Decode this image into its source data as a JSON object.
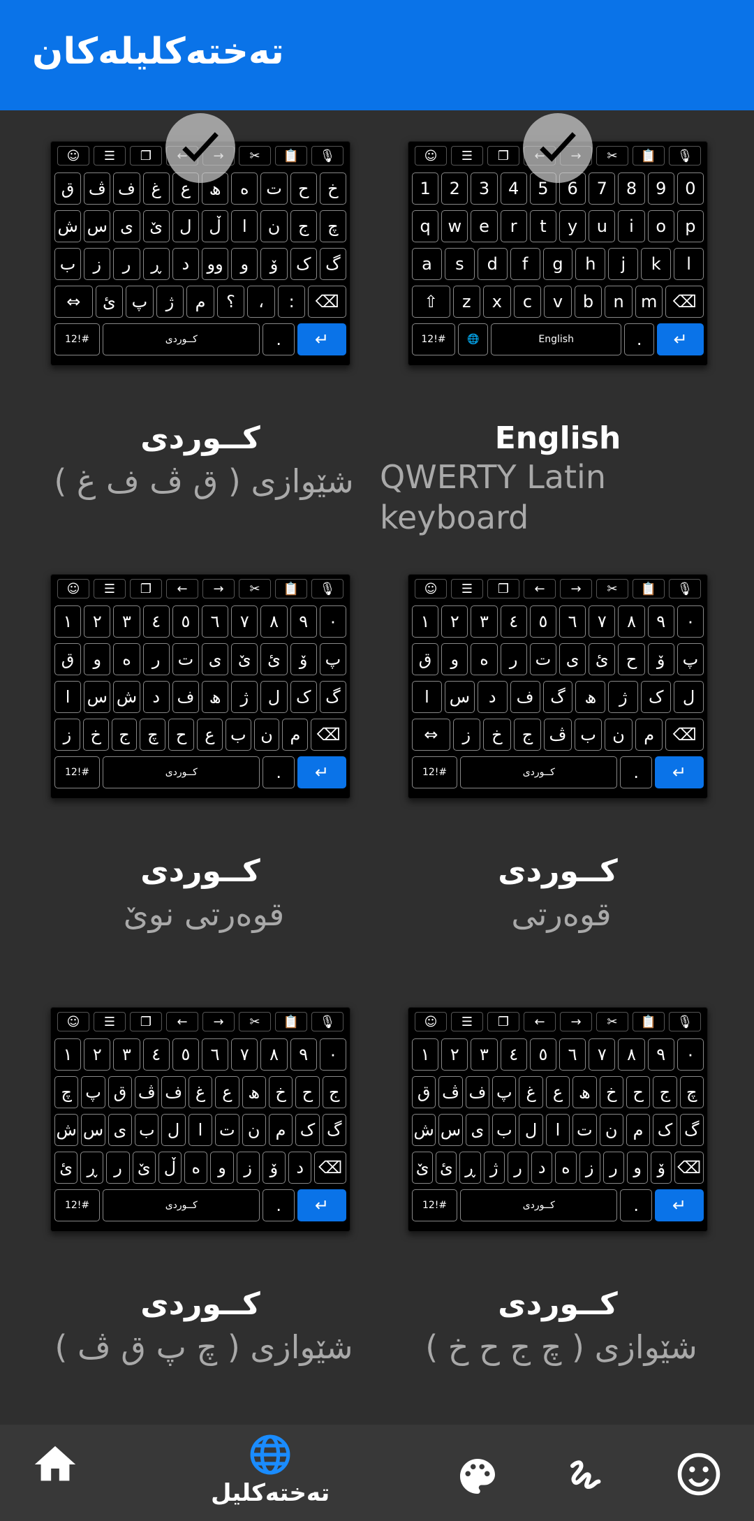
{
  "header": {
    "title": "تەختەکلیلەکان"
  },
  "toolbar_icons": [
    "emoji-icon",
    "keyboard-icon",
    "copy-icon",
    "arrow-left-icon",
    "arrow-right-icon",
    "cut-icon",
    "clipboard-icon",
    "mic-icon"
  ],
  "toolbar_glyphs": [
    "☺",
    "☰",
    "❐",
    "←",
    "→",
    "✂",
    "📋",
    "🎙"
  ],
  "cards": [
    {
      "name": "کــوردی",
      "desc": "شێوازی ( ق ڤ ف غ )",
      "selected": true,
      "rows": [
        [
          "ق",
          "ڤ",
          "ف",
          "غ",
          "ع",
          "ھ",
          "ە",
          "ت",
          "ح",
          "خ"
        ],
        [
          "ش",
          "س",
          "ی",
          "ێ",
          "ل",
          "ڵ",
          "ا",
          "ن",
          "ج",
          "چ"
        ],
        [
          "ب",
          "ز",
          "ر",
          "ڕ",
          "د",
          "وو",
          "و",
          "ۆ",
          "ک",
          "گ"
        ],
        [
          "⇔",
          "ئ",
          "پ",
          "ژ",
          "م",
          "؟",
          "،",
          ":",
          "⌫"
        ]
      ],
      "space": "کــوردی"
    },
    {
      "name": "English",
      "desc": "QWERTY Latin keyboard",
      "selected": true,
      "ltr": true,
      "rows": [
        [
          "1",
          "2",
          "3",
          "4",
          "5",
          "6",
          "7",
          "8",
          "9",
          "0"
        ],
        [
          "q",
          "w",
          "e",
          "r",
          "t",
          "y",
          "u",
          "i",
          "o",
          "p"
        ],
        [
          "a",
          "s",
          "d",
          "f",
          "g",
          "h",
          "j",
          "k",
          "l"
        ],
        [
          "⇧",
          "z",
          "x",
          "c",
          "v",
          "b",
          "n",
          "m",
          "⌫"
        ]
      ],
      "space": "English",
      "globe": true
    },
    {
      "name": "کــوردی",
      "desc": "قوەرتی نوێ",
      "selected": false,
      "rows": [
        [
          "١",
          "٢",
          "٣",
          "٤",
          "٥",
          "٦",
          "٧",
          "٨",
          "٩",
          "٠"
        ],
        [
          "ق",
          "و",
          "ە",
          "ر",
          "ت",
          "ی",
          "ێ",
          "ئ",
          "ۆ",
          "پ"
        ],
        [
          "ا",
          "س",
          "ش",
          "د",
          "ف",
          "ھ",
          "ژ",
          "ل",
          "ک",
          "گ"
        ],
        [
          "ز",
          "خ",
          "ج",
          "چ",
          "ح",
          "ع",
          "ب",
          "ن",
          "م",
          "⌫"
        ]
      ],
      "space": "کــوردی"
    },
    {
      "name": "کــوردی",
      "desc": "قوەرتی",
      "selected": false,
      "rows": [
        [
          "١",
          "٢",
          "٣",
          "٤",
          "٥",
          "٦",
          "٧",
          "٨",
          "٩",
          "٠"
        ],
        [
          "ق",
          "و",
          "ە",
          "ر",
          "ت",
          "ی",
          "ئ",
          "ح",
          "ۆ",
          "پ"
        ],
        [
          "ا",
          "س",
          "د",
          "ف",
          "گ",
          "ھ",
          "ژ",
          "ک",
          "ل"
        ],
        [
          "⇔",
          "ز",
          "خ",
          "ج",
          "ڤ",
          "ب",
          "ن",
          "م",
          "⌫"
        ]
      ],
      "space": "کــوردی"
    },
    {
      "name": "کــوردی",
      "desc": "شێوازی ( چ پ ق ڤ )",
      "selected": false,
      "rows": [
        [
          "١",
          "٢",
          "٣",
          "٤",
          "٥",
          "٦",
          "٧",
          "٨",
          "٩",
          "٠"
        ],
        [
          "چ",
          "پ",
          "ق",
          "ڤ",
          "ف",
          "غ",
          "ع",
          "ھ",
          "خ",
          "ح",
          "ج"
        ],
        [
          "ش",
          "س",
          "ی",
          "ب",
          "ل",
          "ا",
          "ت",
          "ن",
          "م",
          "ک",
          "گ"
        ],
        [
          "ئ",
          "ڕ",
          "ر",
          "ێ",
          "ڵ",
          "ە",
          "و",
          "ز",
          "ۆ",
          "د",
          "⌫"
        ]
      ],
      "space": "کــوردی"
    },
    {
      "name": "کــوردی",
      "desc": "شێوازی ( چ ج ح خ )",
      "selected": false,
      "rows": [
        [
          "١",
          "٢",
          "٣",
          "٤",
          "٥",
          "٦",
          "٧",
          "٨",
          "٩",
          "٠"
        ],
        [
          "ق",
          "ڤ",
          "ف",
          "پ",
          "غ",
          "ع",
          "ھ",
          "خ",
          "ح",
          "ج",
          "چ"
        ],
        [
          "ش",
          "س",
          "ی",
          "ب",
          "ل",
          "ا",
          "ت",
          "ن",
          "م",
          "ک",
          "گ"
        ],
        [
          "ێ",
          "ئ",
          "ڕ",
          "ژ",
          "ر",
          "د",
          "ە",
          "ز",
          "ر",
          "و",
          "ۆ",
          "⌫"
        ]
      ],
      "space": "کــوردی"
    }
  ],
  "bottom_keys": {
    "sym": "12!#",
    "period": "."
  },
  "nav": {
    "items": [
      {
        "icon": "home-icon",
        "label": ""
      },
      {
        "icon": "globe-icon",
        "label": "تەختەکلیل"
      },
      {
        "icon": "palette-icon",
        "label": ""
      },
      {
        "icon": "gesture-icon",
        "label": ""
      },
      {
        "icon": "emoji-icon",
        "label": ""
      }
    ]
  },
  "colors": {
    "accent": "#0a73e8",
    "bg": "#2f2f2f",
    "nav": "#383838"
  }
}
